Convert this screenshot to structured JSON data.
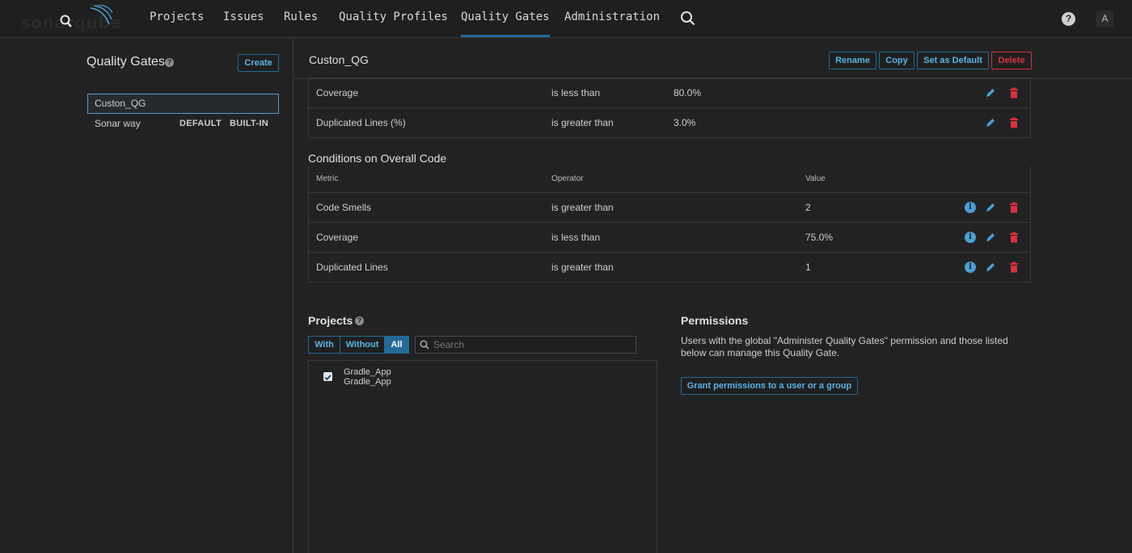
{
  "nav": {
    "logo_text": "sonarqube",
    "items": [
      "Projects",
      "Issues",
      "Rules",
      "Quality Profiles",
      "Quality Gates",
      "Administration"
    ],
    "active": "Quality Gates",
    "help": "?",
    "avatar": "A"
  },
  "sidebar": {
    "title": "Quality Gates",
    "help": "?",
    "create_label": "Create",
    "gates": [
      {
        "name": "Custon_QG",
        "selected": true
      },
      {
        "name": "Sonar way",
        "tags": [
          "DEFAULT",
          "BUILT-IN"
        ]
      }
    ]
  },
  "gate": {
    "name": "Custon_QG",
    "actions": {
      "rename": "Rename",
      "copy": "Copy",
      "set_default": "Set as Default",
      "delete": "Delete"
    }
  },
  "new_code_conditions": [
    {
      "metric": "Coverage",
      "operator": "is less than",
      "value": "80.0%"
    },
    {
      "metric": "Duplicated Lines (%)",
      "operator": "is greater than",
      "value": "3.0%"
    }
  ],
  "overall": {
    "title": "Conditions on Overall Code",
    "headers": {
      "metric": "Metric",
      "operator": "Operator",
      "value": "Value"
    },
    "conditions": [
      {
        "metric": "Code Smells",
        "operator": "is greater than",
        "value": "2"
      },
      {
        "metric": "Coverage",
        "operator": "is less than",
        "value": "75.0%"
      },
      {
        "metric": "Duplicated Lines",
        "operator": "is greater than",
        "value": "1"
      }
    ],
    "info_glyph": "i"
  },
  "projects": {
    "title": "Projects",
    "help": "?",
    "filters": [
      "With",
      "Without",
      "All"
    ],
    "active_filter": "All",
    "search_placeholder": "Search",
    "items": [
      {
        "name": "Gradle_App",
        "key": "Gradle_App",
        "checked": true
      }
    ]
  },
  "permissions": {
    "title": "Permissions",
    "text": "Users with the global \"Administer Quality Gates\" permission and those listed below can manage this Quality Gate.",
    "grant_label": "Grant permissions to a user or a group"
  },
  "colors": {
    "accent": "#236a97",
    "link": "#5bb3e6",
    "danger": "#d4333f",
    "info": "#4b9fd5"
  }
}
